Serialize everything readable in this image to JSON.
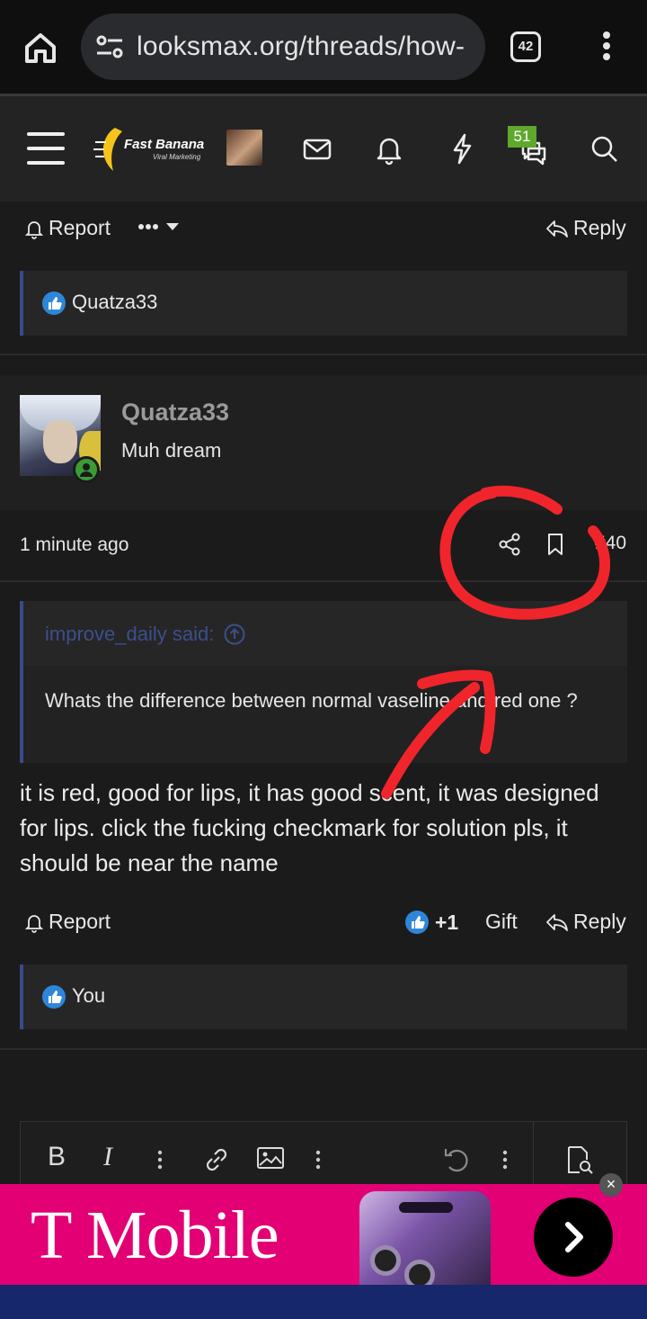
{
  "browser": {
    "url": "looksmax.org/threads/how-",
    "tab_count": "42"
  },
  "header": {
    "logo_text": "Fast Banana",
    "logo_subtext": "Viral Marketing",
    "chat_badge": "51"
  },
  "prev_post": {
    "report_label": "Report",
    "reply_label": "Reply",
    "liked_by": "Quatza33"
  },
  "post": {
    "username": "Quatza33",
    "user_title": "Muh dream",
    "time": "1 minute ago",
    "post_number": "#40",
    "quote_author": "improve_daily said:",
    "quote_text": "Whats the difference between normal vaseline and red one ?",
    "body": "it is red, good for lips, it has good scent, it was designed for lips. click the fucking checkmark for solution pls, it should be near the name",
    "report_label": "Report",
    "like_count": "+1",
    "gift_label": "Gift",
    "reply_label": "Reply",
    "liked_by": "You"
  },
  "editor": {
    "bold": "B",
    "italic": "I"
  },
  "ad": {
    "brand": "T Mobile"
  },
  "colors": {
    "background": "#1b1b1b",
    "ad_magenta": "#e20074",
    "annotation_red": "#f0252b",
    "quote_border": "#3a4a8a"
  }
}
